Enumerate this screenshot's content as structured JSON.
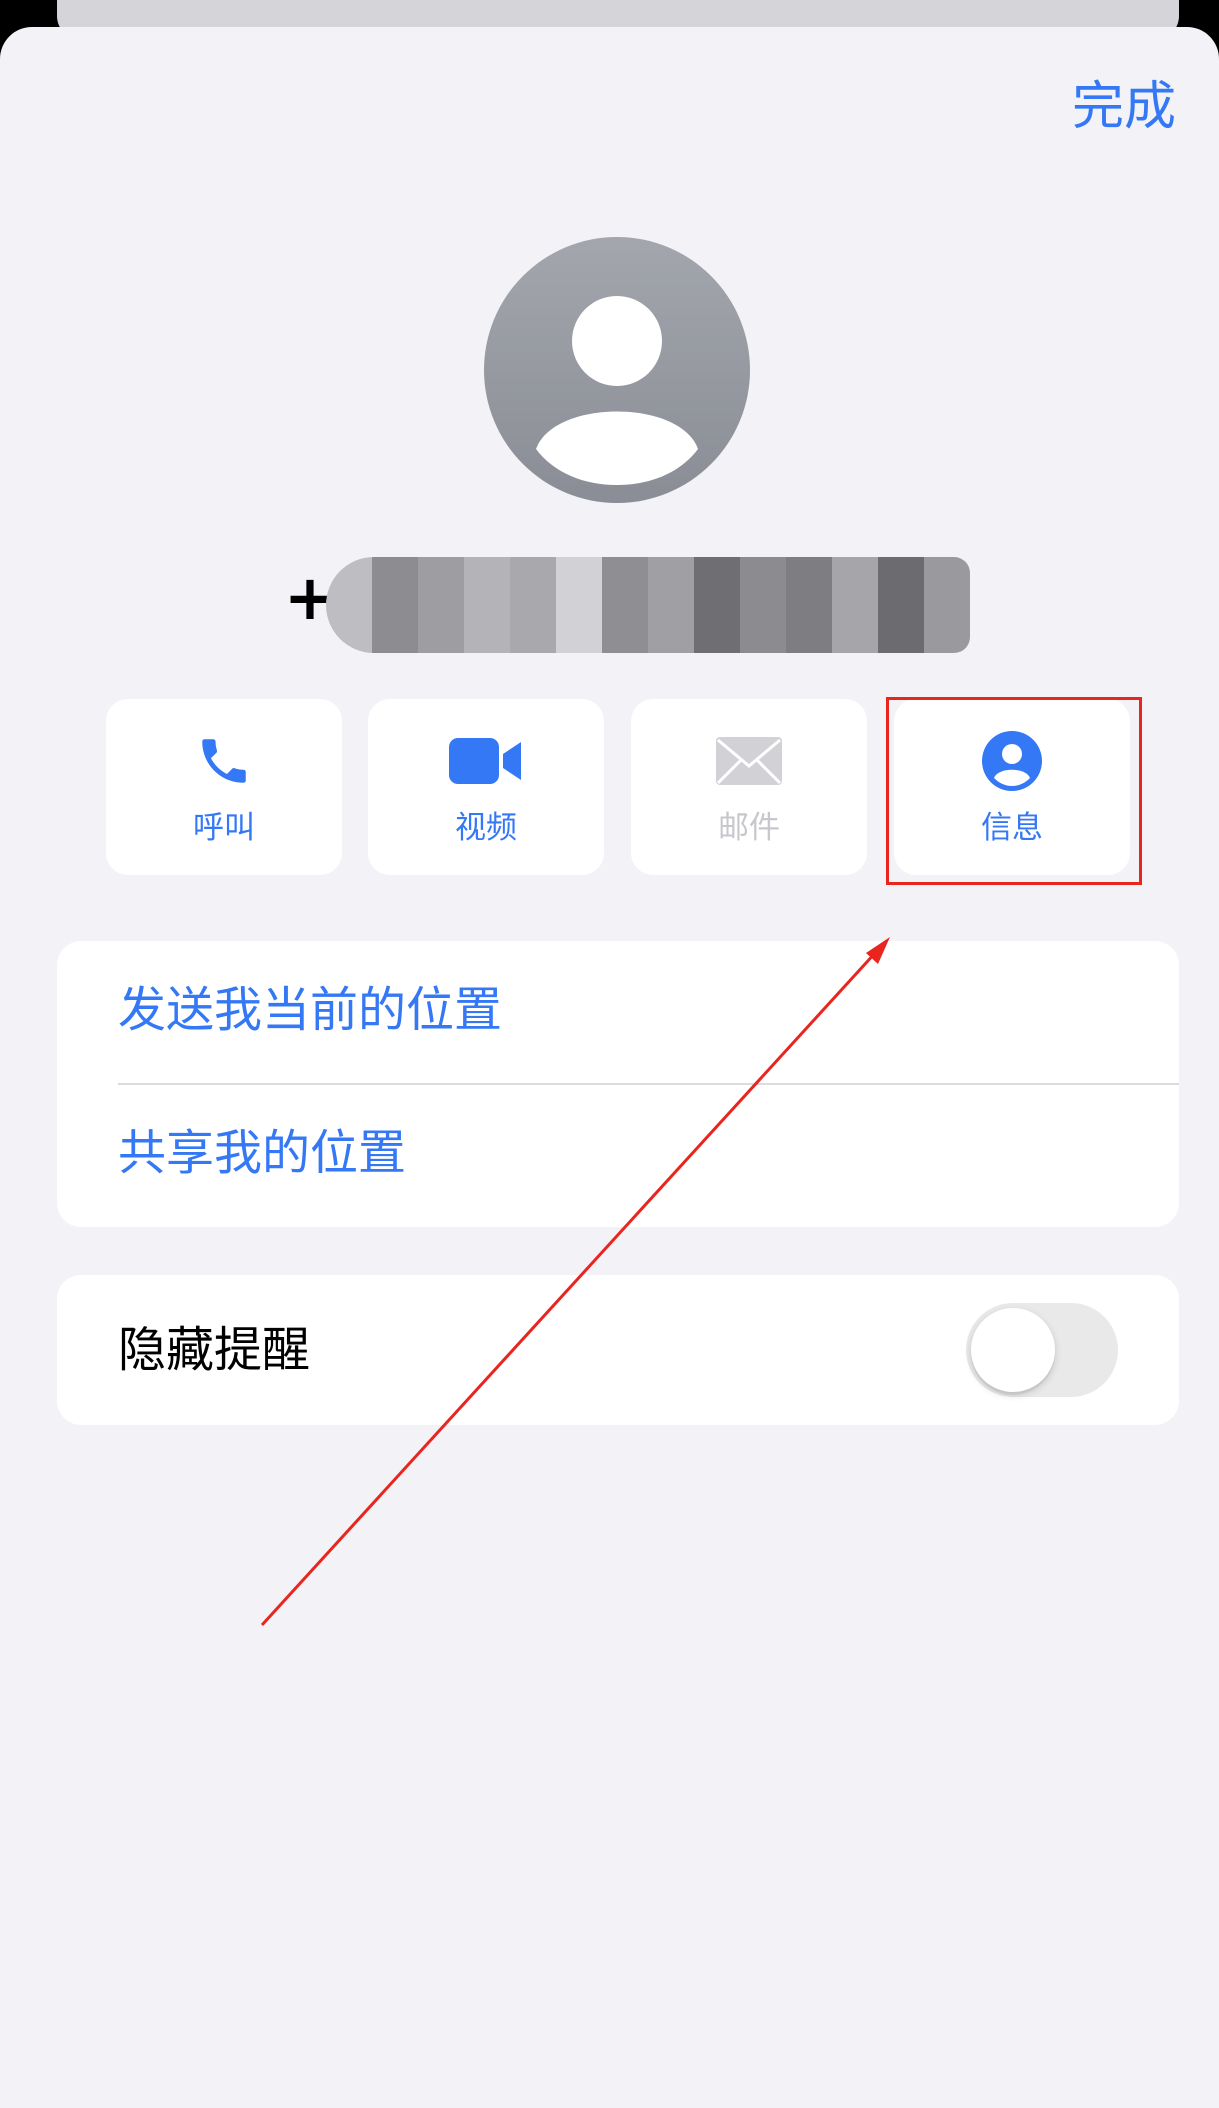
{
  "header": {
    "done_label": "完成"
  },
  "contact": {
    "phone_prefix": "+",
    "phone_number_obscured": true,
    "avatar_icon": "person-placeholder-icon"
  },
  "actions": [
    {
      "label": "呼叫",
      "icon": "phone-icon",
      "enabled": true
    },
    {
      "label": "视频",
      "icon": "video-camera-icon",
      "enabled": true
    },
    {
      "label": "邮件",
      "icon": "envelope-icon",
      "enabled": false
    },
    {
      "label": "信息",
      "icon": "person-circle-icon",
      "enabled": true,
      "highlighted": true
    }
  ],
  "location_group": {
    "send_current_location": "发送我当前的位置",
    "share_my_location": "共享我的位置"
  },
  "hide_alerts": {
    "label": "隐藏提醒",
    "toggle_on": false
  },
  "colors": {
    "accent": "#3478f6",
    "background": "#f2f2f7",
    "annotation_red": "#e8251f",
    "disabled": "#c7c7cc"
  }
}
